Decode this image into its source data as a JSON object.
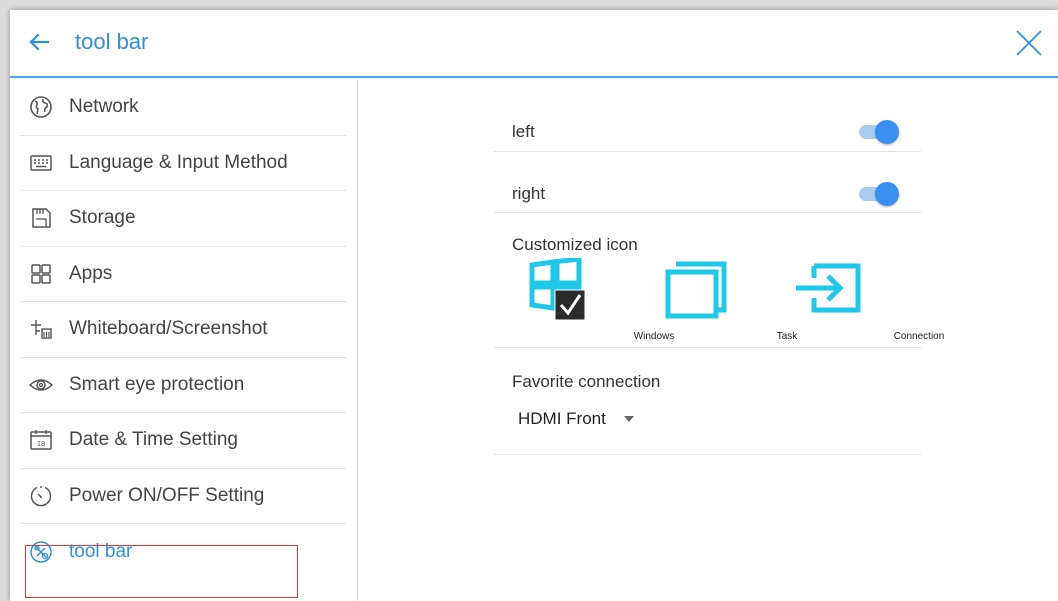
{
  "header": {
    "title": "tool bar"
  },
  "sidebar": {
    "items": [
      {
        "label": "Network",
        "icon": "globe-icon"
      },
      {
        "label": "Language & Input Method",
        "icon": "keyboard-icon"
      },
      {
        "label": "Storage",
        "icon": "sd-card-icon"
      },
      {
        "label": "Apps",
        "icon": "apps-grid-icon"
      },
      {
        "label": "Whiteboard/Screenshot",
        "icon": "whiteboard-icon"
      },
      {
        "label": "Smart eye protection",
        "icon": "eye-icon"
      },
      {
        "label": "Date & Time Setting",
        "icon": "calendar-icon"
      },
      {
        "label": "Power ON/OFF Setting",
        "icon": "power-timer-icon"
      },
      {
        "label": "tool bar",
        "icon": "tool-bar-icon",
        "active": true
      }
    ],
    "calendar_day": "18"
  },
  "settings": {
    "left": {
      "label": "left",
      "enabled": true
    },
    "right": {
      "label": "right",
      "enabled": true
    },
    "customized_icon": {
      "label": "Customized icon",
      "icons": [
        {
          "caption": "Windows",
          "icon": "windows-icon",
          "checked": true
        },
        {
          "caption": "Task",
          "icon": "task-windows-icon",
          "checked": false
        },
        {
          "caption": "Connection",
          "icon": "connection-input-icon",
          "checked": false
        }
      ]
    },
    "favorite_connection": {
      "label": "Favorite connection",
      "value": "HDMI Front"
    }
  },
  "colors": {
    "accent": "#2f8fe0",
    "toggle_on": "#3b8ff0",
    "tile_cyan": "#1fc8e8",
    "selection_outline": "#e0383a"
  }
}
